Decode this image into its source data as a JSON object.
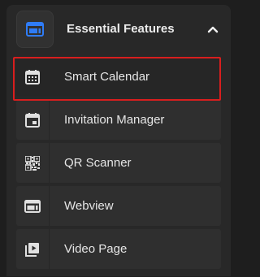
{
  "section": {
    "title": "Essential Features",
    "icon": "webview-icon",
    "accent_color": "#2f7cf6",
    "expanded": true,
    "chevron_icon": "chevron-up-icon"
  },
  "items": [
    {
      "label": "Smart Calendar",
      "icon": "calendar-icon",
      "selected": true
    },
    {
      "label": "Invitation Manager",
      "icon": "event-icon",
      "selected": false
    },
    {
      "label": "QR Scanner",
      "icon": "qr-code-icon",
      "selected": false
    },
    {
      "label": "Webview",
      "icon": "webview-icon",
      "selected": false
    },
    {
      "label": "Video Page",
      "icon": "video-library-icon",
      "selected": false
    }
  ],
  "highlight_color": "#d81e1e"
}
